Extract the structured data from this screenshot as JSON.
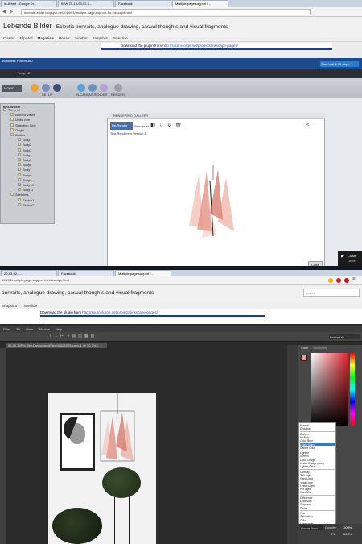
{
  "browser1": {
    "tabs": [
      "In-Arbeit - Google Dr...",
      "IMWITA-18-03-02-1...",
      "Facebook",
      "Multiple page support f..."
    ],
    "url": "lebende-bilder.blogspot.de/2014/03/multiple-page-support-for-inkscape.html"
  },
  "blog": {
    "title": "Lebende Bilder",
    "tagline": "Eclectic portraits, analogue drawing, casual thoughts and visual fragments",
    "nav": [
      "Classic",
      "Flipcard",
      "Magazine",
      "Mosaic",
      "Sidebar",
      "Snapshot",
      "Timeslide"
    ],
    "nav_selected": "Magazine",
    "download_text": "Download the plugin from",
    "download_link": "http://sourceforge.net/projects/inkscape-pages/"
  },
  "fusion": {
    "window_title": "Autodesk Fusion 360",
    "workspace": "MODEL",
    "ribbon_tab": "Temp v2",
    "toolbar_labels": [
      "SETUP",
      "IN-CANVAS RENDER",
      "RENDER"
    ],
    "cta": "Start trial & 30 days",
    "browser_title": "BROWSER",
    "browser_items": [
      "Temp v2",
      "Named Views",
      "Units: mm",
      "Selection Sets",
      "Origin",
      "Bodies",
      "Body1",
      "Body2",
      "Body3",
      "Body4",
      "Body5",
      "Body6",
      "Body7",
      "Body8",
      "Body9",
      "Body10",
      "Body11",
      "Sketches",
      "Sketch1",
      "Sketch2"
    ],
    "gallery_title": "RENDERING GALLERY",
    "gallery_button": "Re-Render",
    "gallery_label": "Render as",
    "gallery_item": "Test Rendering Version 3",
    "close_label": "Close",
    "side_close": "Close",
    "side_note": "Once"
  },
  "browser2": {
    "tabs": [
      "20-03-02-1...",
      "Facebook",
      "Multiple page support f..."
    ],
    "url": "014/03/multiple-page-support-for-inkscape.html",
    "tagline": "portraits, analogue drawing, casual thoughts and visual fragments",
    "search_placeholder": "search",
    "nav": [
      "Snapshot",
      "Timeslide"
    ],
    "download_text": "Download the plugin from",
    "download_link": "http://sourceforge.net/projects/inkscape-pages/"
  },
  "photoshop": {
    "menu": [
      "Filter",
      "3D",
      "View",
      "Window",
      "Help"
    ],
    "doc_tab": "06.40.36PM-990-CustomizedView40626076-copy-1 @ 50.3% (...",
    "mode_label": "Essentials",
    "panel_tabs": [
      "Color",
      "Swatches"
    ],
    "blend_modes": [
      [
        "Normal",
        "Dissolve"
      ],
      [
        "Darken",
        "Multiply",
        "Color Burn",
        "Linear Burn",
        "Darker Color"
      ],
      [
        "Lighten",
        "Screen",
        "Color Dodge",
        "Linear Dodge (Add)",
        "Lighter Color"
      ],
      [
        "Overlay",
        "Soft Light",
        "Hard Light",
        "Vivid Light",
        "Linear Light",
        "Pin Light",
        "Hard Mix"
      ],
      [
        "Difference",
        "Exclusion",
        "Subtract",
        "Divide"
      ],
      [
        "Hue",
        "Saturation",
        "Color",
        "Luminosity"
      ]
    ],
    "blend_selected": "Linear Burn",
    "layer_mode": "Linear Burn",
    "opacity_label": "Opacity:",
    "opacity_value": "100%",
    "fill_label": "Fill:",
    "fill_value": "100%"
  },
  "colors": {
    "fusion_blue": "#1f4a8c",
    "cta_blue": "#2b7cd3",
    "render_red": "#d9604e",
    "ps_dark": "#2b2b2b"
  }
}
